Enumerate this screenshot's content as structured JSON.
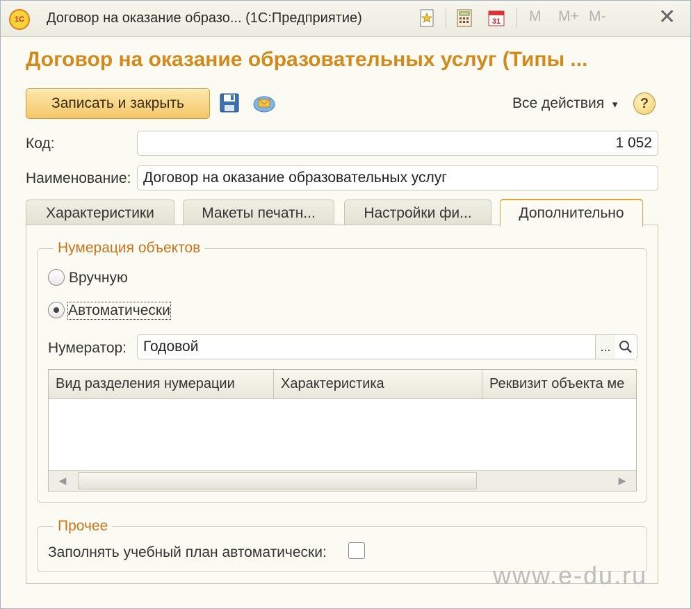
{
  "window": {
    "title": "Договор на оказание образо... (1С:Предприятие)",
    "logo_text": "1С",
    "memory_buttons": [
      "M",
      "M+",
      "M-"
    ],
    "close_glyph": "✕"
  },
  "form": {
    "title": "Договор на оказание образовательных услуг (Типы ...",
    "save_close_label": "Записать и закрыть",
    "all_actions_label": "Все действия",
    "all_actions_arrow": "▾",
    "help_label": "?"
  },
  "fields": {
    "code_label": "Код:",
    "code_value": "1 052",
    "name_label": "Наименование:",
    "name_value": "Договор на оказание образовательных услуг"
  },
  "tabs": [
    {
      "label": "Характеристики"
    },
    {
      "label": "Макеты печатн..."
    },
    {
      "label": "Настройки фи..."
    },
    {
      "label": "Дополнительно"
    }
  ],
  "numbering": {
    "title": "Нумерация объектов",
    "manual_label": "Вручную",
    "auto_label": "Автоматически",
    "selected": "auto",
    "numerator_label": "Нумератор:",
    "numerator_value": "Годовой",
    "picker_label": "...",
    "table_columns": [
      "Вид разделения нумерации",
      "Характеристика",
      "Реквизит объекта ме"
    ],
    "table_rows": []
  },
  "other": {
    "title": "Прочее",
    "fill_plan_label": "Заполнять учебный план автоматически:",
    "fill_plan_checked": false
  },
  "watermark": "www.e-du.ru",
  "colors": {
    "accent_title": "#d18a1b",
    "group_title": "#c9761b",
    "button_bg": "#f3c76a",
    "window_bg": "#fbfbf4"
  }
}
